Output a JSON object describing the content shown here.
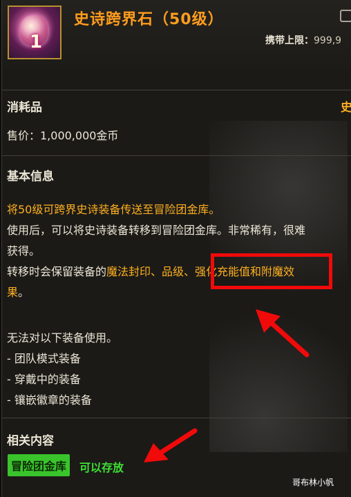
{
  "item": {
    "name": "史诗跨界石（50级）",
    "icon_number": "1",
    "carry_label": "携带上限：",
    "carry_value": "999,9"
  },
  "category": "消耗品",
  "category_right": "史",
  "price": "售价：1,000,000金币",
  "basic_info_title": "基本信息",
  "description": {
    "line1": "将50级可跨界史诗装备传送至冒险团金库。",
    "line2": "使用后，可以将史诗装备转移到冒险团金库。非常稀有，很难",
    "line3": "获得。",
    "line4_prefix": "转移时会保留装备的",
    "line4_highlight": "魔法封印、品级、强化充能值和附魔效",
    "line5_highlight": "果",
    "line5_suffix": "。"
  },
  "restriction": {
    "title": "无法对以下装备使用。",
    "items": [
      "- 团队模式装备",
      "- 穿戴中的装备",
      "- 镶嵌徽章的装备"
    ]
  },
  "related": {
    "title": "相关内容",
    "tag": "冒险团金库",
    "status": "可以存放"
  },
  "watermark": "哥布林小帆",
  "colors": {
    "name": "#ff9d1e",
    "highlight": "#ffb020",
    "status_green": "#3fe033",
    "annotation_red": "#f00a0a"
  }
}
